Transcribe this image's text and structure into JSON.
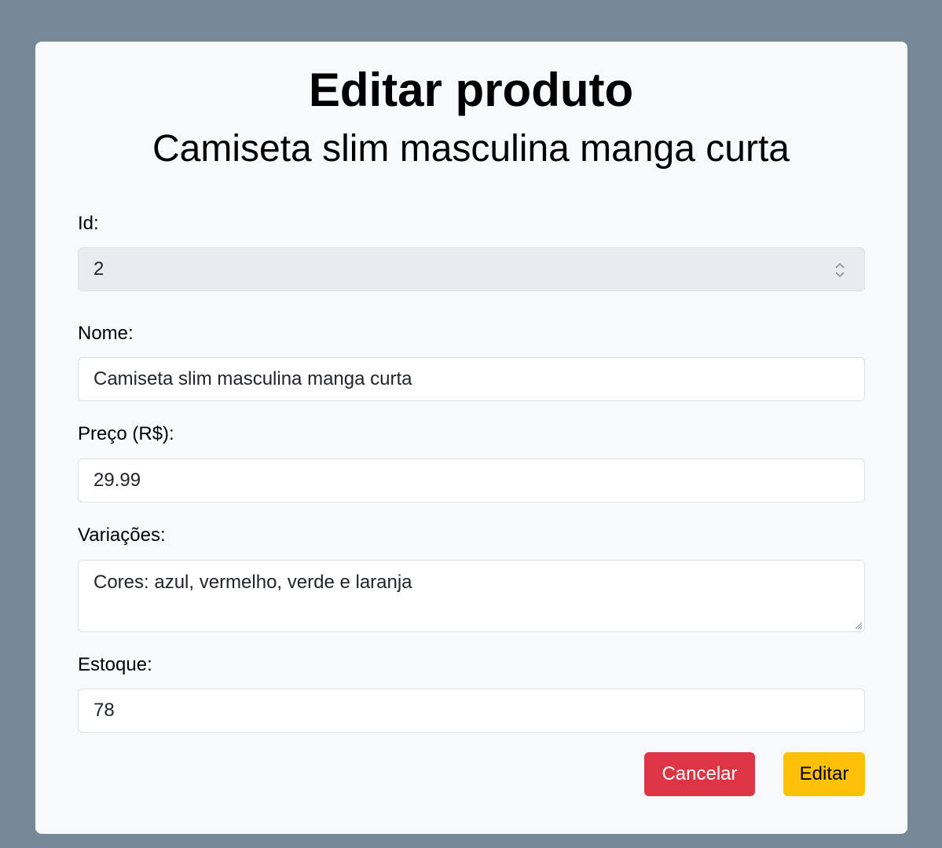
{
  "header": {
    "title": "Editar produto",
    "subtitle": "Camiseta slim masculina manga curta"
  },
  "form": {
    "id": {
      "label": "Id:",
      "value": "2"
    },
    "name": {
      "label": "Nome:",
      "value": "Camiseta slim masculina manga curta"
    },
    "price": {
      "label": "Preço (R$):",
      "value": "29.99"
    },
    "variations": {
      "label": "Variações:",
      "value": "Cores: azul, vermelho, verde e laranja"
    },
    "stock": {
      "label": "Estoque:",
      "value": "78"
    }
  },
  "actions": {
    "cancel_label": "Cancelar",
    "edit_label": "Editar"
  },
  "colors": {
    "background": "#778899",
    "card": "#f8f9fa",
    "cancel": "#dc3545",
    "edit": "#ffc107"
  }
}
